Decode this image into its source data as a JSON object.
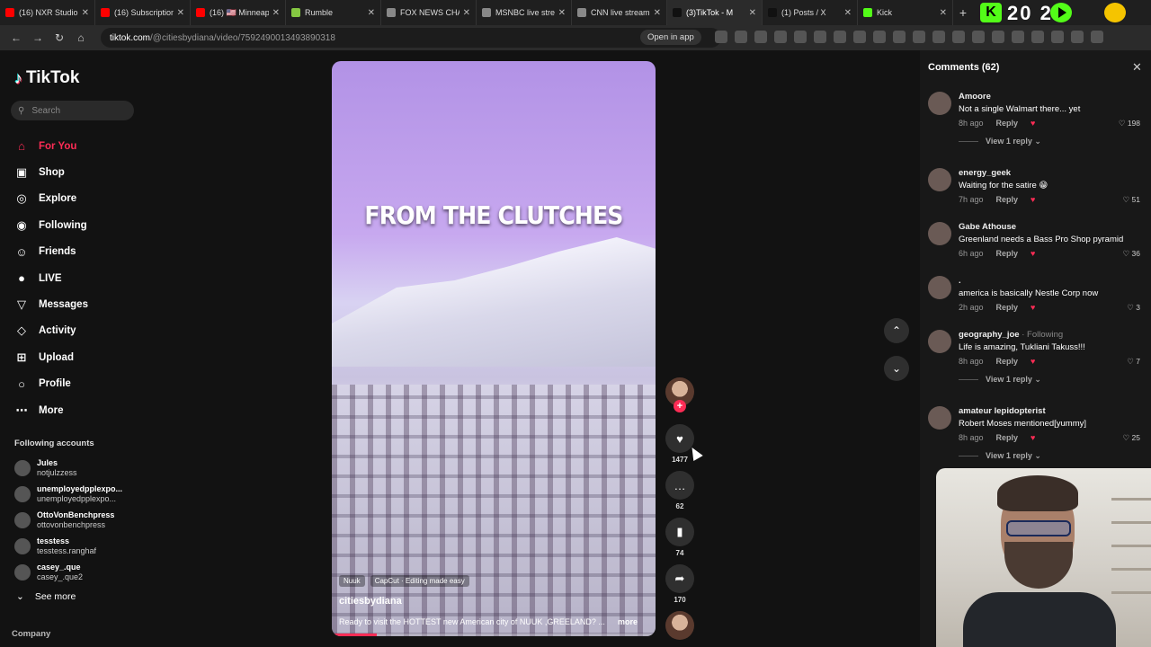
{
  "browser": {
    "tabs": [
      {
        "title": "(16) NXR Studio",
        "color": "#ff0000"
      },
      {
        "title": "(16) Subscription",
        "color": "#ff0000"
      },
      {
        "title": "(16) 🇺🇸 Minneap",
        "color": "#ff0000"
      },
      {
        "title": "Rumble",
        "color": "#85c742"
      },
      {
        "title": "FOX NEWS CHA",
        "color": "#888888"
      },
      {
        "title": "MSNBC live stre",
        "color": "#888888"
      },
      {
        "title": "CNN live stream",
        "color": "#888888"
      },
      {
        "title": "(3)TikTok - M",
        "color": "#111111"
      },
      {
        "title": "(1) Posts / X",
        "color": "#111111"
      },
      {
        "title": "Kick",
        "color": "#53fc18"
      }
    ],
    "extension_counter": "20 2 6",
    "url_host": "tiktok.com",
    "url_path": "/@citiesbydiana/video/7592490013493890318",
    "open_in_app": "Open in app"
  },
  "sidebar": {
    "logo": "TikTok",
    "search_placeholder": "Search",
    "nav": [
      {
        "label": "For You",
        "icon": "home-icon"
      },
      {
        "label": "Shop",
        "icon": "shop-icon"
      },
      {
        "label": "Explore",
        "icon": "compass-icon"
      },
      {
        "label": "Following",
        "icon": "following-icon"
      },
      {
        "label": "Friends",
        "icon": "friends-icon"
      },
      {
        "label": "LIVE",
        "icon": "live-icon"
      },
      {
        "label": "Messages",
        "icon": "messages-icon"
      },
      {
        "label": "Activity",
        "icon": "activity-icon"
      },
      {
        "label": "Upload",
        "icon": "upload-icon"
      },
      {
        "label": "Profile",
        "icon": "profile-icon"
      },
      {
        "label": "More",
        "icon": "more-icon"
      }
    ],
    "following_title": "Following accounts",
    "following": [
      {
        "name": "Jules",
        "handle": "notjulzzess"
      },
      {
        "name": "unemployedpplexpo...",
        "handle": "unemployedpplexpo..."
      },
      {
        "name": "OttoVonBenchpress",
        "handle": "ottovonbenchpress"
      },
      {
        "name": "tesstess",
        "handle": "tesstess.ranghaf"
      },
      {
        "name": "casey_.que",
        "handle": "casey_.que2"
      }
    ],
    "see_more": "See more",
    "company": "Company"
  },
  "video": {
    "overlay_text": "FROM THE CLUTCHES",
    "tags": [
      "Nuuk",
      "CapCut · Editing made easy"
    ],
    "username": "citiesbydiana",
    "description": "Ready to visit the HOTTEST new American city of NUUK ,GREELAND? ...",
    "more": "more",
    "progress": 0.14
  },
  "actions": {
    "likes": "1477",
    "comments": "62",
    "saves": "74",
    "shares": "170"
  },
  "comments": {
    "header": "Comments (62)",
    "items": [
      {
        "user": "Amoore",
        "text": "Not a single Walmart there... yet",
        "time": "8h ago",
        "likes": "198",
        "view_replies": "View 1 reply"
      },
      {
        "user": "energy_geek",
        "text": "Waiting for the satire 😁",
        "time": "7h ago",
        "likes": "51",
        "view_replies": ""
      },
      {
        "user": "Gabe Athouse",
        "text": "Greenland needs a Bass Pro Shop pyramid",
        "time": "6h ago",
        "likes": "36",
        "view_replies": ""
      },
      {
        "user": ".",
        "text": "america is basically Nestle Corp now",
        "time": "2h ago",
        "likes": "3",
        "view_replies": ""
      },
      {
        "user": "geography_joe",
        "following": "· Following",
        "text": "Life is amazing, Tukliani Takuss!!!",
        "time": "8h ago",
        "likes": "7",
        "view_replies": "View 1 reply"
      },
      {
        "user": "amateur lepidopterist",
        "text": "Robert Moses mentioned[yummy]",
        "time": "8h ago",
        "likes": "25",
        "view_replies": "View 1 reply"
      }
    ],
    "reply_label": "Reply"
  }
}
